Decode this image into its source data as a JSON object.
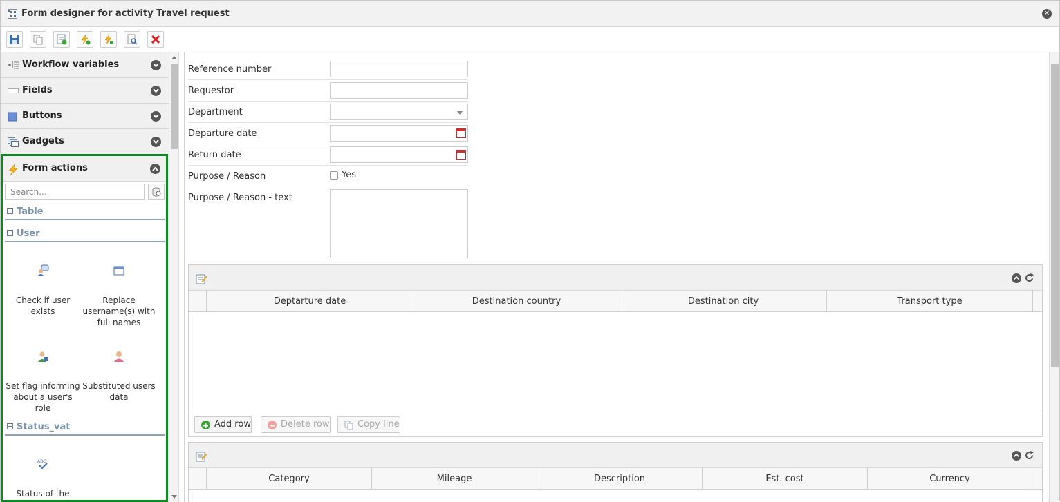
{
  "window": {
    "title": "Form designer for activity Travel request"
  },
  "toolbar": {
    "buttons": [
      "save-icon",
      "copy-icon",
      "add-form-icon",
      "add-action-icon",
      "edit-action-icon",
      "preview-icon",
      "delete-icon"
    ]
  },
  "left_panel": {
    "sections": [
      {
        "label": "Workflow variables",
        "icon": "workflow-variables-icon",
        "expanded": false
      },
      {
        "label": "Fields",
        "icon": "field-icon",
        "expanded": false
      },
      {
        "label": "Buttons",
        "icon": "button-icon",
        "expanded": false
      },
      {
        "label": "Gadgets",
        "icon": "gadget-icon",
        "expanded": false
      },
      {
        "label": "Form actions",
        "icon": "lightning-icon",
        "expanded": true
      }
    ],
    "search": {
      "placeholder": "Search..."
    },
    "groups": [
      {
        "name": "Table",
        "collapsed": true
      },
      {
        "name": "User",
        "collapsed": false,
        "actions": [
          {
            "label": "Check if user exists",
            "icon": "user-check-icon"
          },
          {
            "label": "Replace username(s) with full names",
            "icon": "window-icon"
          },
          {
            "label": "Set flag informing about a user's role",
            "icon": "user-flag-icon"
          },
          {
            "label": "Substituted users data",
            "icon": "user-icon"
          }
        ]
      },
      {
        "name": "Status_vat",
        "collapsed": false,
        "actions": [
          {
            "label": "Status of the",
            "icon": "abc-check-icon"
          }
        ]
      }
    ]
  },
  "form": {
    "fields": [
      {
        "label": "Reference number",
        "type": "text",
        "value": ""
      },
      {
        "label": "Requestor",
        "type": "text",
        "value": ""
      },
      {
        "label": "Department",
        "type": "dropdown",
        "value": ""
      },
      {
        "label": "Departure date",
        "type": "date",
        "value": ""
      },
      {
        "label": "Return date",
        "type": "date",
        "value": ""
      },
      {
        "label": "Purpose / Reason",
        "type": "checkbox",
        "checkbox_label": "Yes",
        "checked": false
      },
      {
        "label": "Purpose / Reason - text",
        "type": "textarea",
        "value": ""
      }
    ]
  },
  "grids": [
    {
      "columns": [
        "Deptarture date",
        "Destination country",
        "Destination city",
        "Transport type"
      ],
      "buttons": {
        "add_row": "Add row",
        "delete_row": "Delete row",
        "copy_line": "Copy line"
      }
    },
    {
      "columns": [
        "Category",
        "Mileage",
        "Description",
        "Est. cost",
        "Currency"
      ]
    }
  ],
  "colors": {
    "highlight_border": "#0b8a1f",
    "group_title": "#7c94ad",
    "delete_red": "#e02020"
  }
}
